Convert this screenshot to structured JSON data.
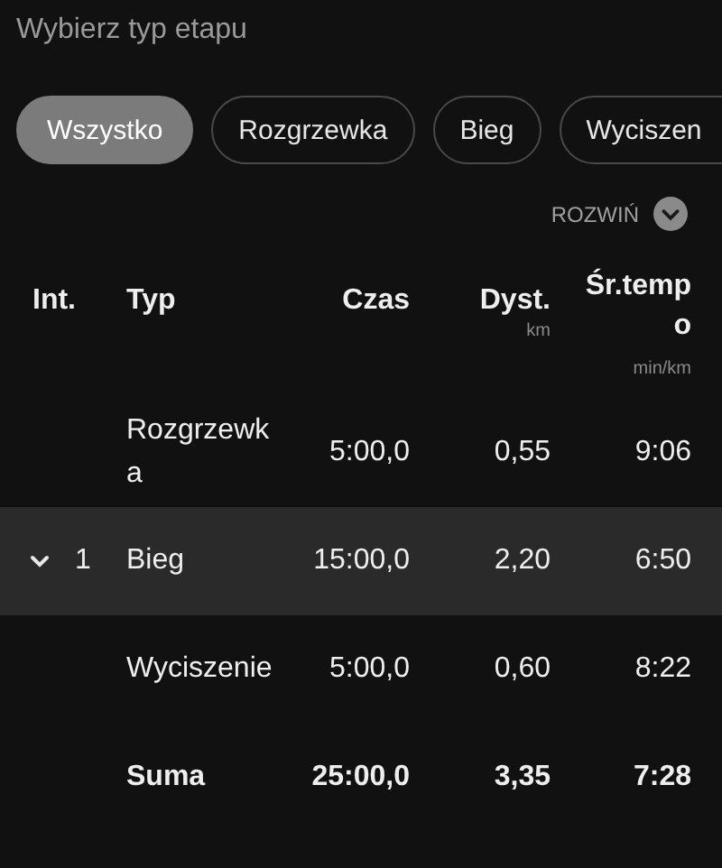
{
  "filter_label": "Wybierz typ etapu",
  "chips": [
    {
      "label": "Wszystko",
      "selected": true
    },
    {
      "label": "Rozgrzewka",
      "selected": false
    },
    {
      "label": "Bieg",
      "selected": false
    },
    {
      "label": "Wyciszen",
      "selected": false
    }
  ],
  "expand_link": "ROZWIŃ",
  "table": {
    "columns": [
      {
        "label": "Int."
      },
      {
        "label": "Typ"
      },
      {
        "label": "Czas"
      },
      {
        "label": "Dyst.",
        "unit": "km"
      },
      {
        "label": "Śr.tempo",
        "unit": "min/km"
      }
    ],
    "rows": [
      {
        "kind": "segment",
        "selected": false,
        "type": "Rozgrzewka",
        "time": "5:00,0",
        "distance": "0,55",
        "pace": "9:06"
      },
      {
        "kind": "interval",
        "interval": "1",
        "selected": true,
        "type": "Bieg",
        "time": "15:00,0",
        "distance": "2,20",
        "pace": "6:50"
      },
      {
        "kind": "segment",
        "selected": false,
        "type": "Wyciszenie",
        "time": "5:00,0",
        "distance": "0,60",
        "pace": "8:22"
      },
      {
        "kind": "total",
        "selected": false,
        "type": "Suma",
        "time": "25:00,0",
        "distance": "3,35",
        "pace": "7:28"
      }
    ]
  }
}
